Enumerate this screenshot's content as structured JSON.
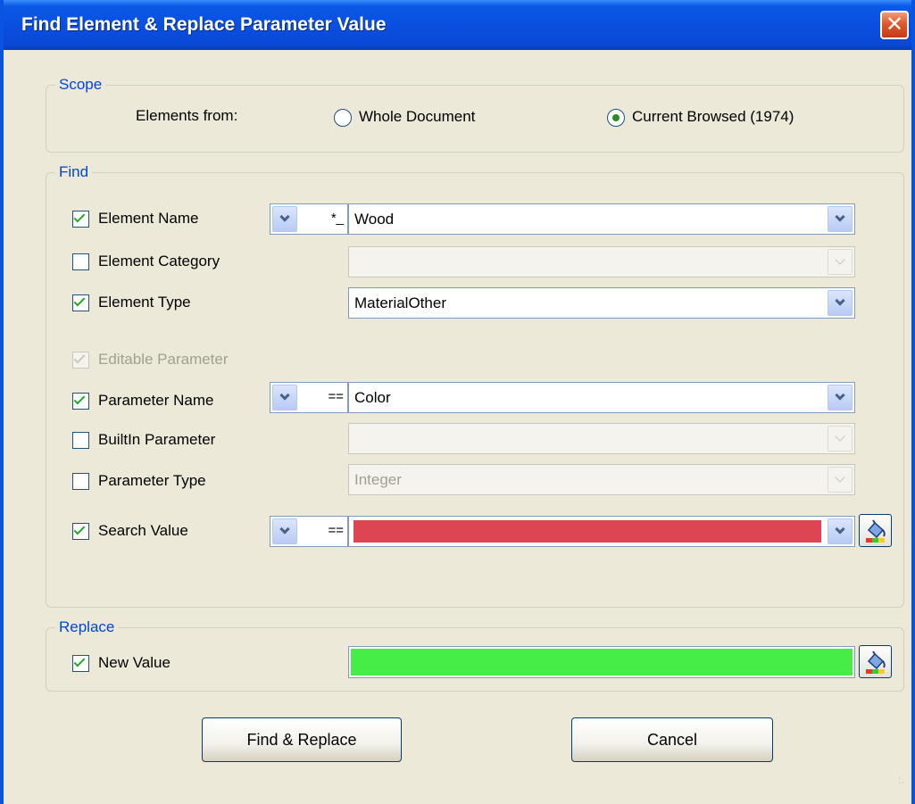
{
  "window": {
    "title": "Find Element & Replace Parameter Value",
    "close_symbol": "✕"
  },
  "scope": {
    "group_label": "Scope",
    "elements_from_label": "Elements from:",
    "options": [
      {
        "label": "Whole Document",
        "selected": false
      },
      {
        "label": "Current Browsed (1974)",
        "selected": true
      }
    ]
  },
  "find": {
    "group_label": "Find",
    "element_name": {
      "label": "Element Name",
      "checked": true,
      "operator": "*_",
      "value": "Wood"
    },
    "element_category": {
      "label": "Element Category",
      "checked": false,
      "value": ""
    },
    "element_type": {
      "label": "Element Type",
      "checked": true,
      "value": "MaterialOther"
    },
    "editable_parameter": {
      "label": "Editable Parameter",
      "checked": true,
      "enabled": false
    },
    "parameter_name": {
      "label": "Parameter Name",
      "checked": true,
      "operator": "==",
      "value": "Color"
    },
    "builtin_parameter": {
      "label": "BuiltIn Parameter",
      "checked": false,
      "value": ""
    },
    "parameter_type": {
      "label": "Parameter Type",
      "checked": false,
      "value": "Integer"
    },
    "search_value": {
      "label": "Search Value",
      "checked": true,
      "operator": "==",
      "color": "#de4552"
    }
  },
  "replace": {
    "group_label": "Replace",
    "new_value": {
      "label": "New Value",
      "checked": true,
      "color": "#47ed47"
    }
  },
  "buttons": {
    "find_replace": "Find & Replace",
    "cancel": "Cancel"
  },
  "colors": {
    "title_bar": "#0a4fe0",
    "group_label": "#0046d5",
    "window_bg": "#ece9d8",
    "close_button": "#e0582a"
  },
  "icons": {
    "close": "close-icon",
    "dropdown": "chevron-down-icon",
    "color_picker": "paint-bucket-icon"
  }
}
